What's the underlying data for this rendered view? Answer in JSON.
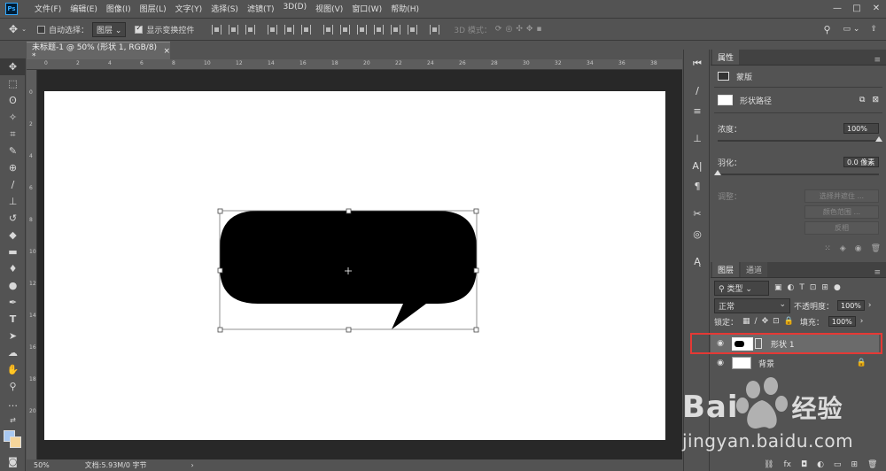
{
  "menu": {
    "logo": "Ps",
    "items": [
      "文件(F)",
      "编辑(E)",
      "图像(I)",
      "图层(L)",
      "文字(Y)",
      "选择(S)",
      "滤镜(T)",
      "3D(D)",
      "视图(V)",
      "窗口(W)",
      "帮助(H)"
    ]
  },
  "window_controls": [
    "—",
    "□",
    "✕"
  ],
  "options_bar": {
    "auto_select_label": "自动选择：",
    "auto_select_value": "图层",
    "show_transform_label": "显示变换控件",
    "mode_3d_label": "3D 模式："
  },
  "document_tab": {
    "title": "未标题-1 @ 50% (形状 1, RGB/8) *",
    "close": "×"
  },
  "rulers": {
    "top": [
      "0",
      "2",
      "4",
      "6",
      "8",
      "10",
      "12",
      "14",
      "16",
      "18",
      "20",
      "22",
      "24",
      "26",
      "28",
      "30",
      "32",
      "34",
      "36",
      "38"
    ],
    "left": [
      "0",
      "2",
      "4",
      "6",
      "8",
      "10",
      "12",
      "14",
      "16",
      "18",
      "20"
    ]
  },
  "status": {
    "zoom": "50%",
    "doc_info": "文档:5.93M/0 字节",
    "arrow": "›"
  },
  "properties": {
    "tab": "属性",
    "mask_label": "蒙版",
    "shape_path_label": "形状路径",
    "density_label": "浓度：",
    "density_value": "100%",
    "density_level": 1.0,
    "feather_label": "羽化：",
    "feather_value": "0.0 像素",
    "feather_level": 0.0,
    "adjust_label": "调整：",
    "select_mask_button": "选择并遮住 ...",
    "color_range_button": "颜色范围 ...",
    "invert_button": "反相"
  },
  "layers": {
    "tabs": [
      "图层",
      "通道"
    ],
    "filter_label": "类型",
    "blend_mode": "正常",
    "opacity_label": "不透明度：",
    "opacity_value": "100%",
    "lock_label": "锁定：",
    "fill_label": "填充：",
    "fill_value": "100%",
    "items": [
      {
        "name": "形状 1",
        "visible": true,
        "selected": true
      },
      {
        "name": "背景",
        "visible": true,
        "locked": true
      }
    ]
  },
  "watermark": {
    "brand": "Bai",
    "brand_tail": "经验",
    "url": "jingyan.baidu.com"
  },
  "colors": {
    "ui_bg": "#535353",
    "workspace": "#282828",
    "canvas": "#ffffff",
    "highlight": "#e53935",
    "shape_fill": "#000000"
  }
}
